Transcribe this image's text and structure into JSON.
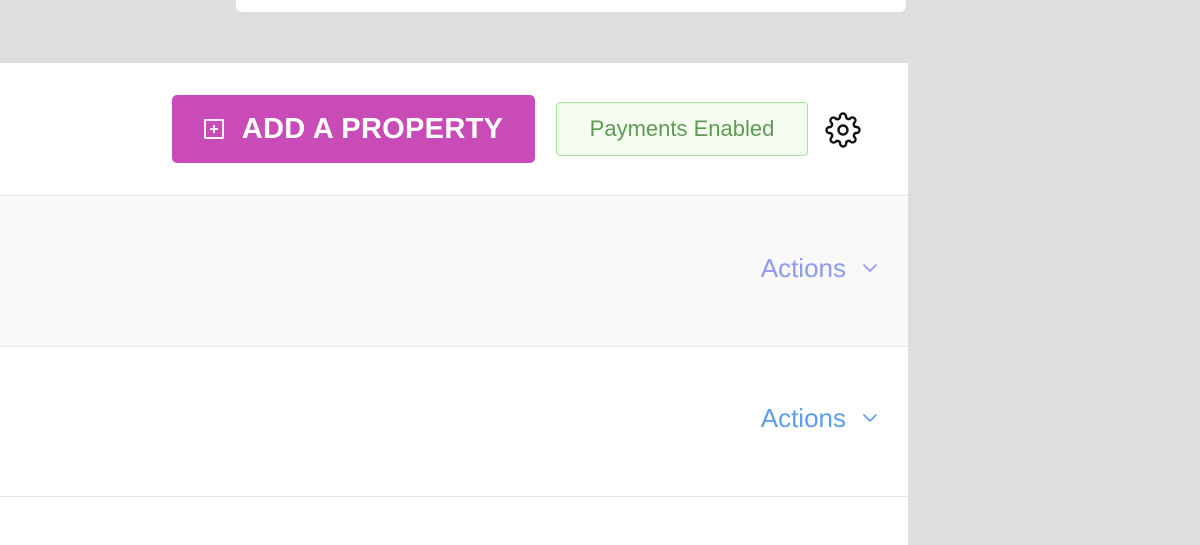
{
  "header": {
    "add_button_label": "ADD A PROPERTY",
    "payments_badge": "Payments Enabled"
  },
  "rows": [
    {
      "actions_label": "Actions"
    },
    {
      "actions_label": "Actions"
    }
  ],
  "colors": {
    "accent": "#c94bb8",
    "badge_text": "#5f9a54",
    "badge_border": "#a6e39a",
    "link_row_1": "#8d99f5",
    "link_row_2": "#5c9df0"
  }
}
